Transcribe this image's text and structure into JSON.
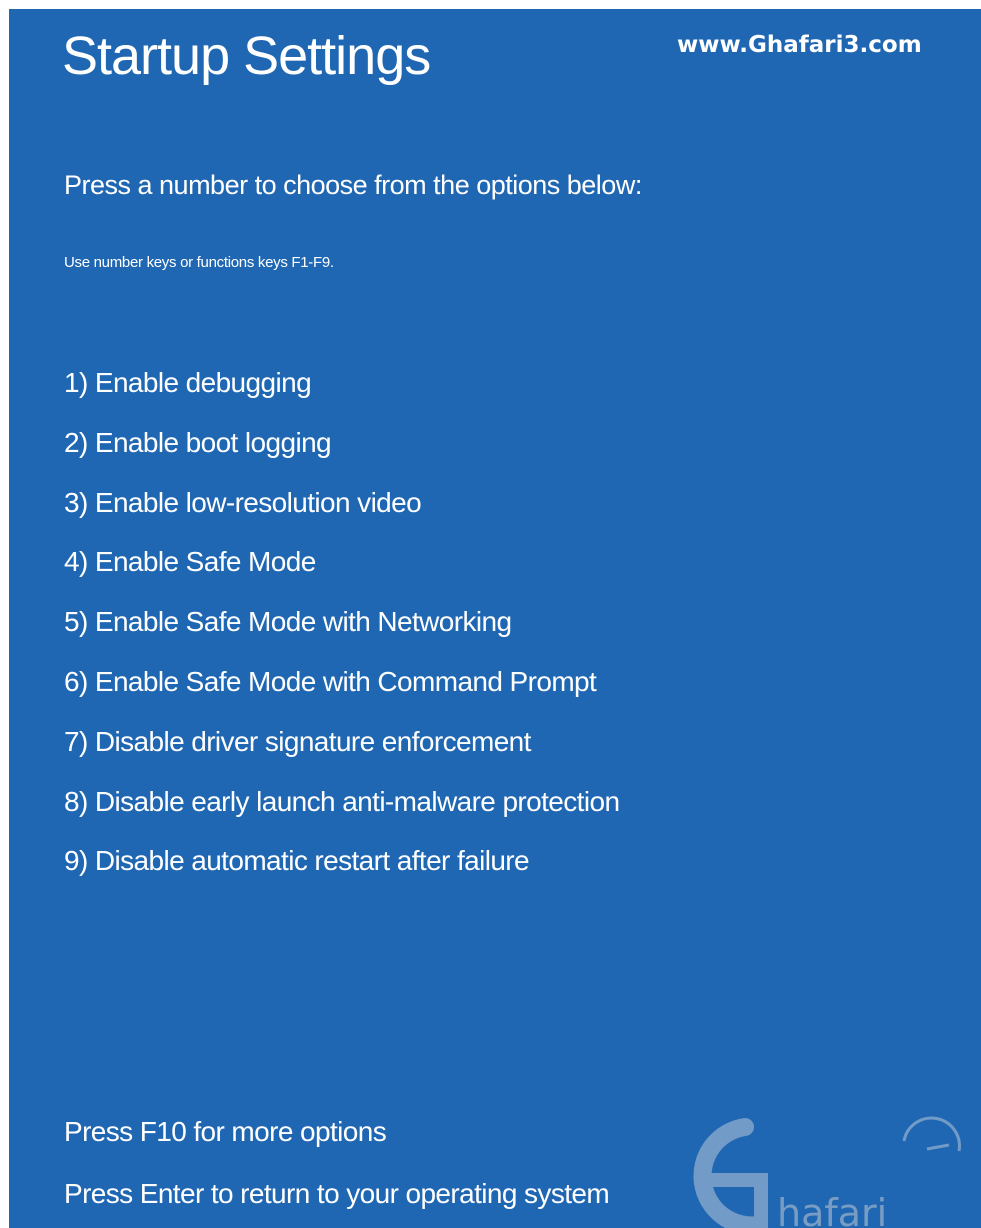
{
  "screen": {
    "title": "Startup Settings",
    "watermark_url": "www.Ghafari3.com",
    "instruction": "Press a number to choose from the options below:",
    "hint": "Use number keys or functions keys F1-F9.",
    "options": [
      {
        "label": "1) Enable debugging"
      },
      {
        "label": "2) Enable boot logging"
      },
      {
        "label": "3) Enable low-resolution video"
      },
      {
        "label": "4) Enable Safe Mode"
      },
      {
        "label": "5) Enable Safe Mode with Networking"
      },
      {
        "label": "6) Enable Safe Mode with Command Prompt"
      },
      {
        "label": "7) Disable driver signature enforcement"
      },
      {
        "label": "8) Disable early launch anti-malware protection"
      },
      {
        "label": "9) Disable automatic restart after failure"
      }
    ],
    "footer": {
      "more_options": "Press F10 for more options",
      "return": "Press Enter to return to your operating system"
    },
    "logo": {
      "text": "hafari"
    }
  },
  "colors": {
    "background": "#1f67b3",
    "text": "#ffffff",
    "outer_border": "#ffffff"
  }
}
